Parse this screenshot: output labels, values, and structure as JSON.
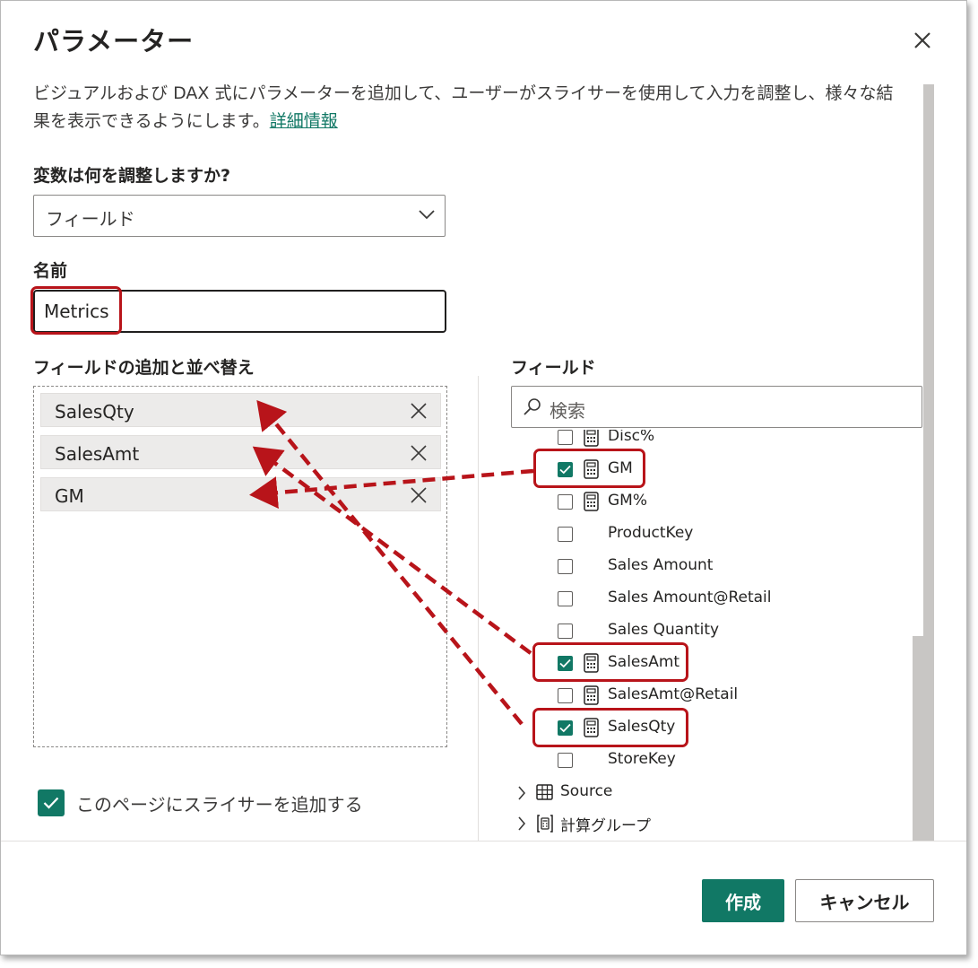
{
  "dialog": {
    "title": "パラメーター",
    "description": "ビジュアルおよび DAX 式にパラメーターを追加して、ユーザーがスライサーを使用して入力を調整し、様々な結果を表示できるようにします。",
    "learn_more": "詳細情報"
  },
  "variable": {
    "label": "変数は何を調整しますか?",
    "selected": "フィールド"
  },
  "name": {
    "label": "名前",
    "value": "Metrics"
  },
  "well": {
    "label": "フィールドの追加と並べ替え",
    "items": [
      "SalesQty",
      "SalesAmt",
      "GM"
    ]
  },
  "fields": {
    "label": "フィールド",
    "search_placeholder": "検索",
    "items": [
      {
        "label": "Disc%",
        "checked": false,
        "icon": "calculator-icon"
      },
      {
        "label": "GM",
        "checked": true,
        "icon": "calculator-icon"
      },
      {
        "label": "GM%",
        "checked": false,
        "icon": "calculator-icon"
      },
      {
        "label": "ProductKey",
        "checked": false,
        "icon": ""
      },
      {
        "label": "Sales Amount",
        "checked": false,
        "icon": ""
      },
      {
        "label": "Sales Amount@Retail",
        "checked": false,
        "icon": ""
      },
      {
        "label": "Sales Quantity",
        "checked": false,
        "icon": ""
      },
      {
        "label": "SalesAmt",
        "checked": true,
        "icon": "calculator-icon"
      },
      {
        "label": "SalesAmt@Retail",
        "checked": false,
        "icon": "calculator-icon"
      },
      {
        "label": "SalesQty",
        "checked": true,
        "icon": "calculator-icon"
      },
      {
        "label": "StoreKey",
        "checked": false,
        "icon": ""
      }
    ],
    "tables": [
      {
        "label": "Source",
        "icon": "table-icon"
      },
      {
        "label": "計算グループ",
        "icon": "calculation-group-icon"
      }
    ]
  },
  "slicer_option": {
    "label": "このページにスライサーを追加する",
    "checked": true
  },
  "buttons": {
    "create": "作成",
    "cancel": "キャンセル"
  },
  "colors": {
    "accent": "#117865",
    "annotation": "#b8141a"
  }
}
